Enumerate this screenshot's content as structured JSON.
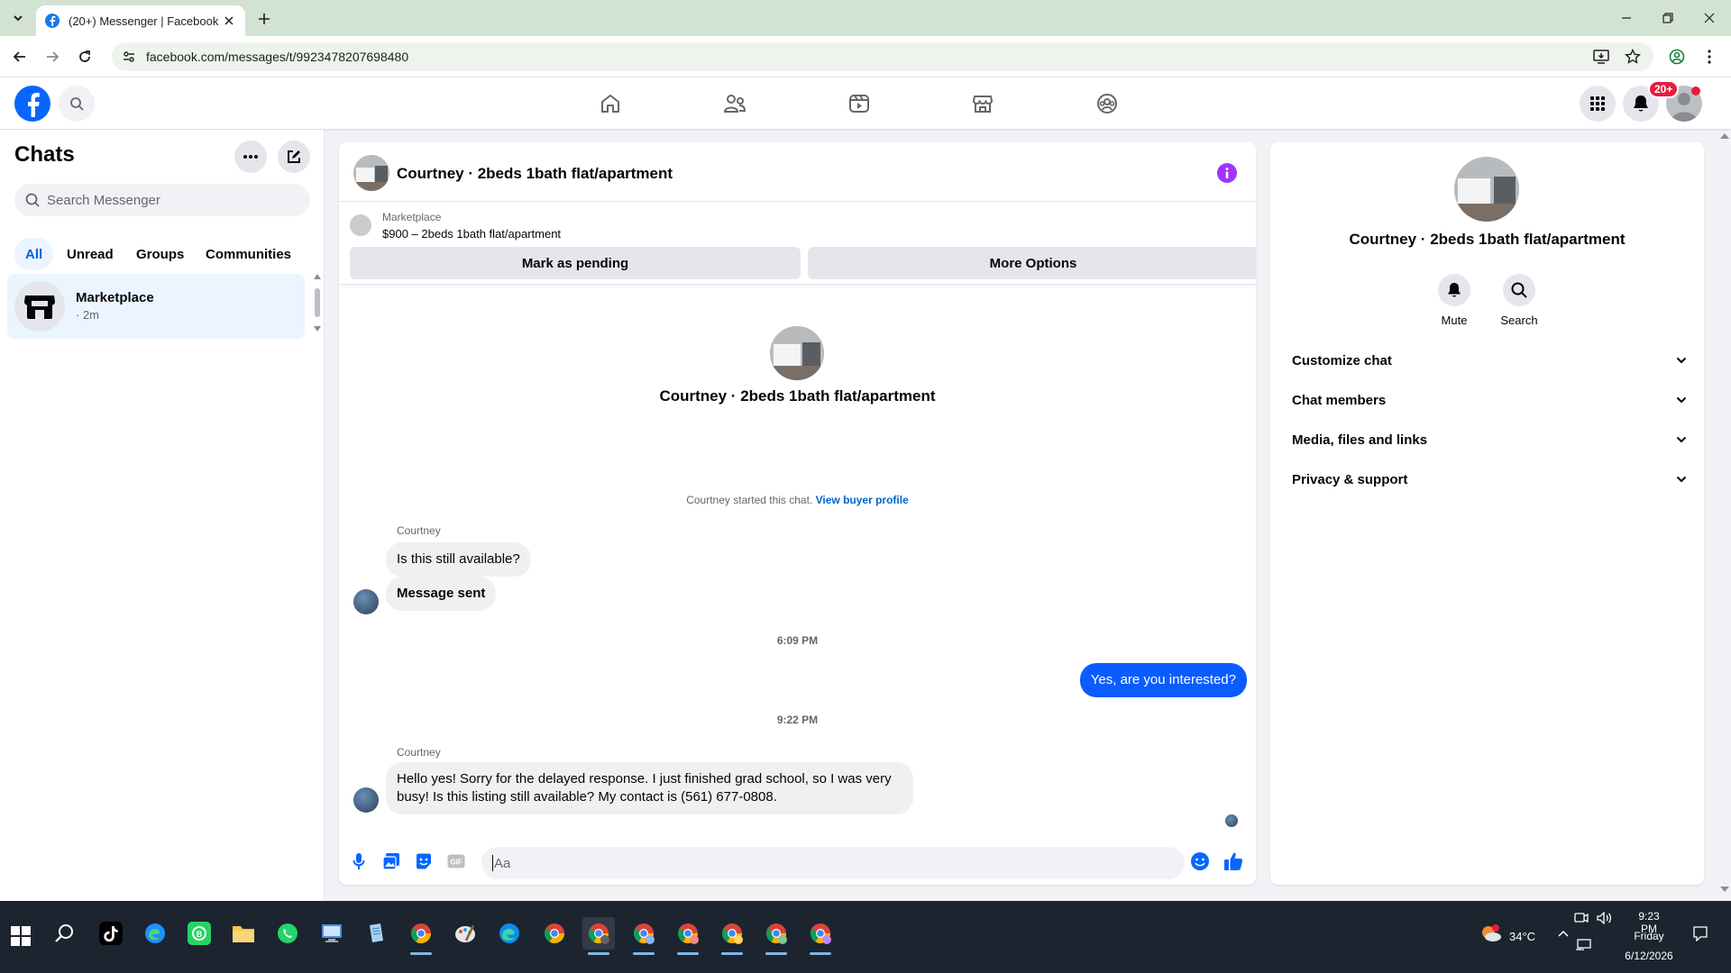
{
  "browser": {
    "tab_title": "(20+) Messenger | Facebook",
    "url": "facebook.com/messages/t/9923478207698480"
  },
  "fb_header": {
    "notification_badge": "20+"
  },
  "left": {
    "title": "Chats",
    "search_placeholder": "Search Messenger",
    "filters": [
      "All",
      "Unread",
      "Groups",
      "Communities"
    ],
    "active_filter": "All",
    "chats": [
      {
        "name": "Marketplace",
        "time": "· 2m"
      }
    ]
  },
  "conversation": {
    "title": "Courtney · 2beds 1bath flat/apartment",
    "marketplace_label": "Marketplace",
    "listing": "$900 – 2beds 1bath flat/apartment",
    "mark_pending_label": "Mark as pending",
    "more_options_label": "More Options",
    "intro_name": "Courtney · 2beds 1bath flat/apartment",
    "started_text": "Courtney started this chat.",
    "view_profile_link": "View buyer profile",
    "messages": [
      {
        "sender": "Courtney",
        "text": "Is this still available?"
      },
      {
        "text": "Message sent"
      },
      {
        "timestamp": "6:09 PM"
      },
      {
        "outgoing": true,
        "text": "Yes, are you interested?"
      },
      {
        "timestamp": "9:22 PM"
      },
      {
        "sender": "Courtney",
        "text": "Hello yes! Sorry for the delayed response. I just finished grad school, so I was very busy! Is this listing still available? My contact is (561) 677-0808."
      }
    ],
    "composer_placeholder": "Aa",
    "accent_color": "#0a5cff"
  },
  "right": {
    "name": "Courtney · 2beds 1bath flat/apartment",
    "actions": [
      "Mute",
      "Search"
    ],
    "sections": [
      "Customize chat",
      "Chat members",
      "Media, files and links",
      "Privacy & support"
    ]
  },
  "taskbar": {
    "weather": "34°C",
    "time": "9:23 PM",
    "day": "Friday",
    "date": "6/12/2026"
  }
}
